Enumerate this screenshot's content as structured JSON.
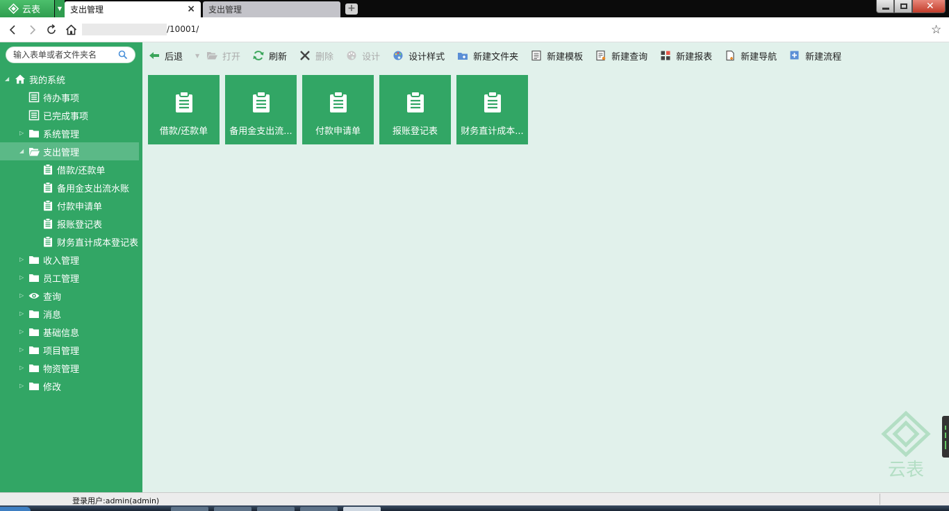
{
  "app": {
    "name": "云表"
  },
  "tabs": [
    {
      "label": "支出管理",
      "active": true
    },
    {
      "label": "支出管理",
      "active": false
    }
  ],
  "address": {
    "url": "/10001/"
  },
  "sidebar": {
    "search_placeholder": "输入表单或者文件夹名",
    "root": "我的系统",
    "items": [
      {
        "label": "待办事项",
        "icon": "list-icon"
      },
      {
        "label": "已完成事项",
        "icon": "list-icon"
      },
      {
        "label": "系统管理",
        "icon": "folder-icon"
      },
      {
        "label": "支出管理",
        "icon": "folder-icon",
        "expanded": true,
        "children": [
          {
            "label": "借款/还款单",
            "icon": "clipboard-icon"
          },
          {
            "label": "备用金支出流水账",
            "icon": "clipboard-icon"
          },
          {
            "label": "付款申请单",
            "icon": "clipboard-icon"
          },
          {
            "label": "报账登记表",
            "icon": "clipboard-icon"
          },
          {
            "label": "财务直计成本登记表",
            "icon": "clipboard-icon"
          }
        ]
      },
      {
        "label": "收入管理",
        "icon": "folder-icon"
      },
      {
        "label": "员工管理",
        "icon": "folder-icon"
      },
      {
        "label": "查询",
        "icon": "eye-icon"
      },
      {
        "label": "消息",
        "icon": "folder-icon"
      },
      {
        "label": "基础信息",
        "icon": "folder-icon"
      },
      {
        "label": "项目管理",
        "icon": "folder-icon"
      },
      {
        "label": "物资管理",
        "icon": "folder-icon"
      },
      {
        "label": "修改",
        "icon": "folder-icon"
      }
    ]
  },
  "toolbar": {
    "back": "后退",
    "open": "打开",
    "refresh": "刷新",
    "delete": "删除",
    "design": "设计",
    "design_style": "设计样式",
    "new_folder": "新建文件夹",
    "new_template": "新建模板",
    "new_query": "新建查询",
    "new_report": "新建报表",
    "new_nav": "新建导航",
    "new_flow": "新建流程"
  },
  "tiles": [
    {
      "label": "借款/还款单"
    },
    {
      "label": "备用金支出流..."
    },
    {
      "label": "付款申请单"
    },
    {
      "label": "报账登记表"
    },
    {
      "label": "财务直计成本..."
    }
  ],
  "watermark": {
    "text": "云表"
  },
  "status": {
    "user": "登录用户:admin(admin)"
  },
  "colors": {
    "accent": "#32a665",
    "main_bg": "#e1f1eb",
    "selected": "#5bb987"
  }
}
